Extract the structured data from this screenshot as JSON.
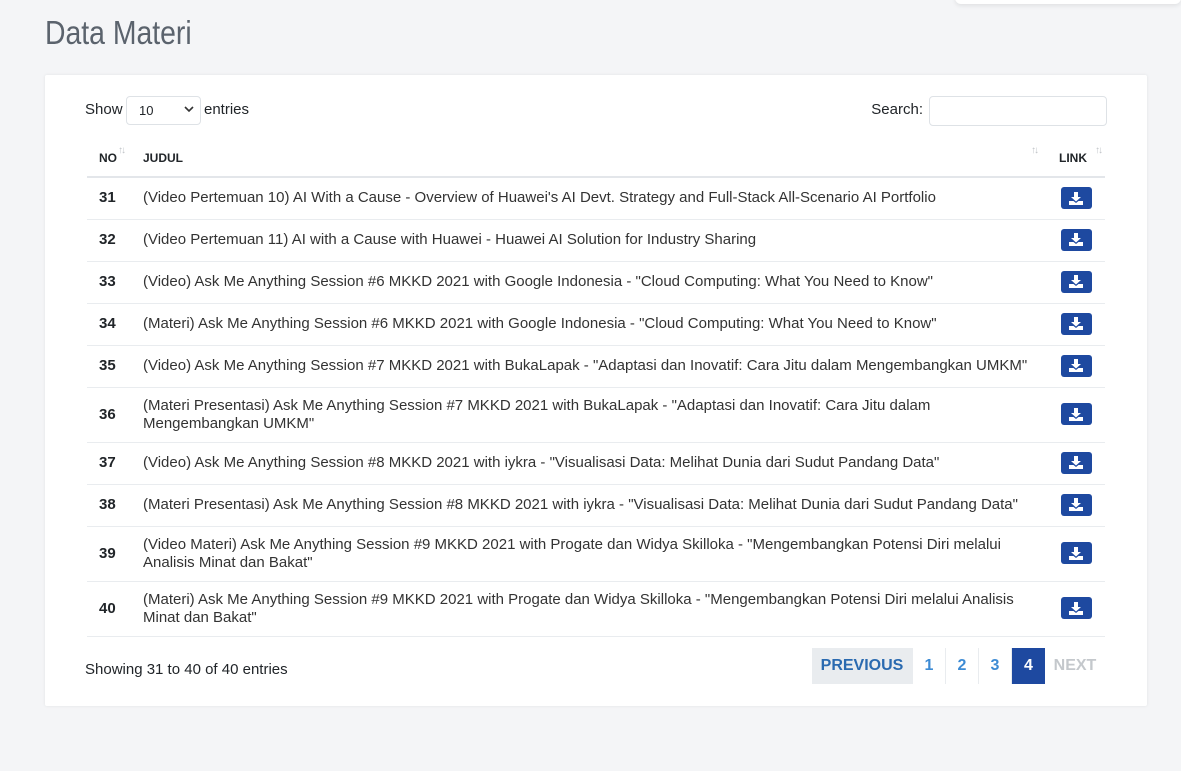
{
  "page": {
    "title": "Data Materi"
  },
  "controls": {
    "show_label": "Show",
    "length_value": "10",
    "entries_label": "entries",
    "search_label": "Search:",
    "search_value": ""
  },
  "table": {
    "headers": {
      "no": "NO",
      "judul": "JUDUL",
      "link": "LINK"
    },
    "rows": [
      {
        "no": "31",
        "judul": "(Video Pertemuan 10) AI With a Cause - Overview of Huawei's AI Devt. Strategy and Full-Stack All-Scenario AI Portfolio"
      },
      {
        "no": "32",
        "judul": "(Video Pertemuan 11) AI with a Cause with Huawei - Huawei AI Solution for Industry Sharing"
      },
      {
        "no": "33",
        "judul": "(Video) Ask Me Anything Session #6 MKKD 2021 with Google Indonesia - \"Cloud Computing: What You Need to Know\""
      },
      {
        "no": "34",
        "judul": "(Materi) Ask Me Anything Session #6 MKKD 2021 with Google Indonesia - \"Cloud Computing: What You Need to Know\""
      },
      {
        "no": "35",
        "judul": "(Video) Ask Me Anything Session #7 MKKD 2021 with BukaLapak - \"Adaptasi dan Inovatif: Cara Jitu dalam Mengembangkan UMKM\""
      },
      {
        "no": "36",
        "judul": "(Materi Presentasi) Ask Me Anything Session #7 MKKD 2021 with BukaLapak - \"Adaptasi dan Inovatif: Cara Jitu dalam Mengembangkan UMKM\""
      },
      {
        "no": "37",
        "judul": "(Video) Ask Me Anything Session #8 MKKD 2021 with iykra - \"Visualisasi Data: Melihat Dunia dari Sudut Pandang Data\""
      },
      {
        "no": "38",
        "judul": "(Materi Presentasi) Ask Me Anything Session #8 MKKD 2021 with iykra - \"Visualisasi Data: Melihat Dunia dari Sudut Pandang Data\""
      },
      {
        "no": "39",
        "judul": "(Video Materi) Ask Me Anything Session #9 MKKD 2021 with Progate dan Widya Skilloka - \"Mengembangkan Potensi Diri melalui Analisis Minat dan Bakat\""
      },
      {
        "no": "40",
        "judul": "(Materi) Ask Me Anything Session #9 MKKD 2021 with Progate dan Widya Skilloka - \"Mengembangkan Potensi Diri melalui Analisis Minat dan Bakat\""
      }
    ]
  },
  "footer": {
    "info": "Showing 31 to 40 of 40 entries",
    "pagination": {
      "previous": "PREVIOUS",
      "pages": [
        "1",
        "2",
        "3",
        "4"
      ],
      "active": "4",
      "next": "NEXT"
    }
  },
  "colors": {
    "primary": "#1e49a0",
    "link": "#3d8bd4",
    "background": "#f4f5f7"
  }
}
